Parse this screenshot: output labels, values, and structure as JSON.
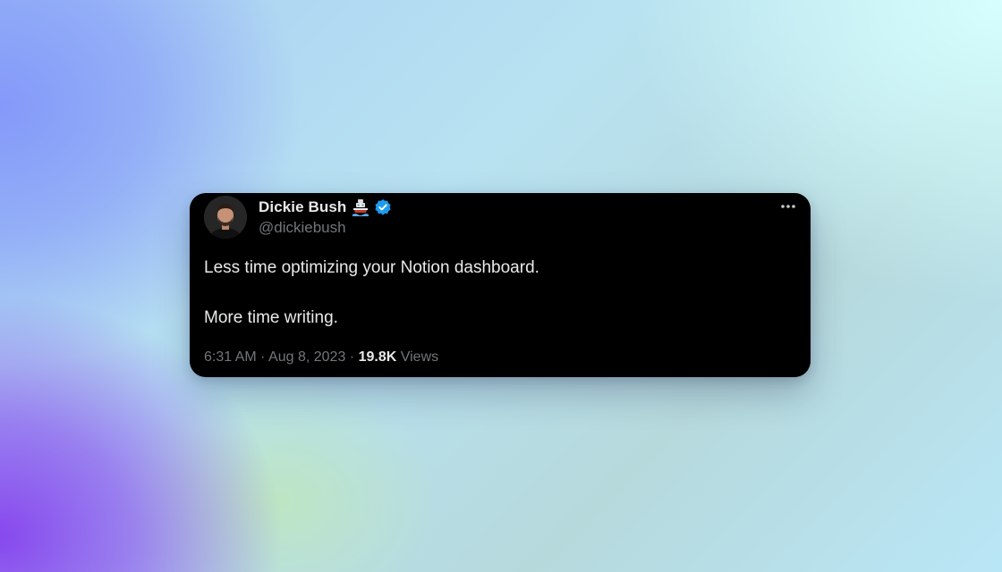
{
  "tweet": {
    "author": {
      "display_name": "Dickie Bush",
      "emoji_icon": "ship-icon",
      "verified_icon": "verified-badge-icon",
      "verified_color": "#1d9bf0",
      "handle": "@dickiebush"
    },
    "more_icon": "more-options-icon",
    "text": [
      "Less time optimizing your Notion dashboard.",
      "More time writing."
    ],
    "meta": {
      "time": "6:31 AM",
      "separator": "·",
      "date": "Aug 8, 2023",
      "views_count": "19.8K",
      "views_label": "Views"
    }
  },
  "colors": {
    "card_background": "#000000",
    "primary_text": "#e7e9ea",
    "secondary_text": "#71767b"
  }
}
